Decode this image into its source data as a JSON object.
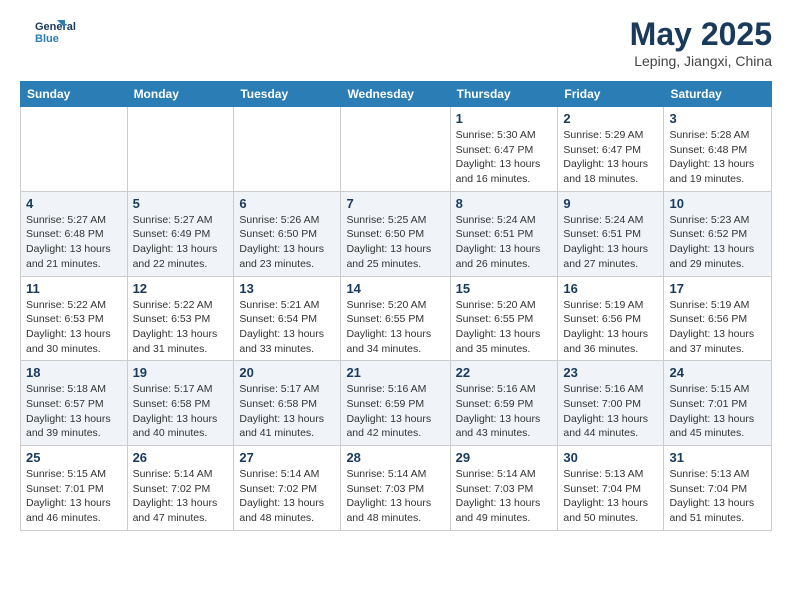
{
  "header": {
    "logo_line1": "General",
    "logo_line2": "Blue",
    "title": "May 2025",
    "subtitle": "Leping, Jiangxi, China"
  },
  "weekdays": [
    "Sunday",
    "Monday",
    "Tuesday",
    "Wednesday",
    "Thursday",
    "Friday",
    "Saturday"
  ],
  "weeks": [
    [
      {
        "day": "",
        "sunrise": "",
        "sunset": "",
        "daylight": ""
      },
      {
        "day": "",
        "sunrise": "",
        "sunset": "",
        "daylight": ""
      },
      {
        "day": "",
        "sunrise": "",
        "sunset": "",
        "daylight": ""
      },
      {
        "day": "",
        "sunrise": "",
        "sunset": "",
        "daylight": ""
      },
      {
        "day": "1",
        "sunrise": "Sunrise: 5:30 AM",
        "sunset": "Sunset: 6:47 PM",
        "daylight": "Daylight: 13 hours and 16 minutes."
      },
      {
        "day": "2",
        "sunrise": "Sunrise: 5:29 AM",
        "sunset": "Sunset: 6:47 PM",
        "daylight": "Daylight: 13 hours and 18 minutes."
      },
      {
        "day": "3",
        "sunrise": "Sunrise: 5:28 AM",
        "sunset": "Sunset: 6:48 PM",
        "daylight": "Daylight: 13 hours and 19 minutes."
      }
    ],
    [
      {
        "day": "4",
        "sunrise": "Sunrise: 5:27 AM",
        "sunset": "Sunset: 6:48 PM",
        "daylight": "Daylight: 13 hours and 21 minutes."
      },
      {
        "day": "5",
        "sunrise": "Sunrise: 5:27 AM",
        "sunset": "Sunset: 6:49 PM",
        "daylight": "Daylight: 13 hours and 22 minutes."
      },
      {
        "day": "6",
        "sunrise": "Sunrise: 5:26 AM",
        "sunset": "Sunset: 6:50 PM",
        "daylight": "Daylight: 13 hours and 23 minutes."
      },
      {
        "day": "7",
        "sunrise": "Sunrise: 5:25 AM",
        "sunset": "Sunset: 6:50 PM",
        "daylight": "Daylight: 13 hours and 25 minutes."
      },
      {
        "day": "8",
        "sunrise": "Sunrise: 5:24 AM",
        "sunset": "Sunset: 6:51 PM",
        "daylight": "Daylight: 13 hours and 26 minutes."
      },
      {
        "day": "9",
        "sunrise": "Sunrise: 5:24 AM",
        "sunset": "Sunset: 6:51 PM",
        "daylight": "Daylight: 13 hours and 27 minutes."
      },
      {
        "day": "10",
        "sunrise": "Sunrise: 5:23 AM",
        "sunset": "Sunset: 6:52 PM",
        "daylight": "Daylight: 13 hours and 29 minutes."
      }
    ],
    [
      {
        "day": "11",
        "sunrise": "Sunrise: 5:22 AM",
        "sunset": "Sunset: 6:53 PM",
        "daylight": "Daylight: 13 hours and 30 minutes."
      },
      {
        "day": "12",
        "sunrise": "Sunrise: 5:22 AM",
        "sunset": "Sunset: 6:53 PM",
        "daylight": "Daylight: 13 hours and 31 minutes."
      },
      {
        "day": "13",
        "sunrise": "Sunrise: 5:21 AM",
        "sunset": "Sunset: 6:54 PM",
        "daylight": "Daylight: 13 hours and 33 minutes."
      },
      {
        "day": "14",
        "sunrise": "Sunrise: 5:20 AM",
        "sunset": "Sunset: 6:55 PM",
        "daylight": "Daylight: 13 hours and 34 minutes."
      },
      {
        "day": "15",
        "sunrise": "Sunrise: 5:20 AM",
        "sunset": "Sunset: 6:55 PM",
        "daylight": "Daylight: 13 hours and 35 minutes."
      },
      {
        "day": "16",
        "sunrise": "Sunrise: 5:19 AM",
        "sunset": "Sunset: 6:56 PM",
        "daylight": "Daylight: 13 hours and 36 minutes."
      },
      {
        "day": "17",
        "sunrise": "Sunrise: 5:19 AM",
        "sunset": "Sunset: 6:56 PM",
        "daylight": "Daylight: 13 hours and 37 minutes."
      }
    ],
    [
      {
        "day": "18",
        "sunrise": "Sunrise: 5:18 AM",
        "sunset": "Sunset: 6:57 PM",
        "daylight": "Daylight: 13 hours and 39 minutes."
      },
      {
        "day": "19",
        "sunrise": "Sunrise: 5:17 AM",
        "sunset": "Sunset: 6:58 PM",
        "daylight": "Daylight: 13 hours and 40 minutes."
      },
      {
        "day": "20",
        "sunrise": "Sunrise: 5:17 AM",
        "sunset": "Sunset: 6:58 PM",
        "daylight": "Daylight: 13 hours and 41 minutes."
      },
      {
        "day": "21",
        "sunrise": "Sunrise: 5:16 AM",
        "sunset": "Sunset: 6:59 PM",
        "daylight": "Daylight: 13 hours and 42 minutes."
      },
      {
        "day": "22",
        "sunrise": "Sunrise: 5:16 AM",
        "sunset": "Sunset: 6:59 PM",
        "daylight": "Daylight: 13 hours and 43 minutes."
      },
      {
        "day": "23",
        "sunrise": "Sunrise: 5:16 AM",
        "sunset": "Sunset: 7:00 PM",
        "daylight": "Daylight: 13 hours and 44 minutes."
      },
      {
        "day": "24",
        "sunrise": "Sunrise: 5:15 AM",
        "sunset": "Sunset: 7:01 PM",
        "daylight": "Daylight: 13 hours and 45 minutes."
      }
    ],
    [
      {
        "day": "25",
        "sunrise": "Sunrise: 5:15 AM",
        "sunset": "Sunset: 7:01 PM",
        "daylight": "Daylight: 13 hours and 46 minutes."
      },
      {
        "day": "26",
        "sunrise": "Sunrise: 5:14 AM",
        "sunset": "Sunset: 7:02 PM",
        "daylight": "Daylight: 13 hours and 47 minutes."
      },
      {
        "day": "27",
        "sunrise": "Sunrise: 5:14 AM",
        "sunset": "Sunset: 7:02 PM",
        "daylight": "Daylight: 13 hours and 48 minutes."
      },
      {
        "day": "28",
        "sunrise": "Sunrise: 5:14 AM",
        "sunset": "Sunset: 7:03 PM",
        "daylight": "Daylight: 13 hours and 48 minutes."
      },
      {
        "day": "29",
        "sunrise": "Sunrise: 5:14 AM",
        "sunset": "Sunset: 7:03 PM",
        "daylight": "Daylight: 13 hours and 49 minutes."
      },
      {
        "day": "30",
        "sunrise": "Sunrise: 5:13 AM",
        "sunset": "Sunset: 7:04 PM",
        "daylight": "Daylight: 13 hours and 50 minutes."
      },
      {
        "day": "31",
        "sunrise": "Sunrise: 5:13 AM",
        "sunset": "Sunset: 7:04 PM",
        "daylight": "Daylight: 13 hours and 51 minutes."
      }
    ]
  ]
}
